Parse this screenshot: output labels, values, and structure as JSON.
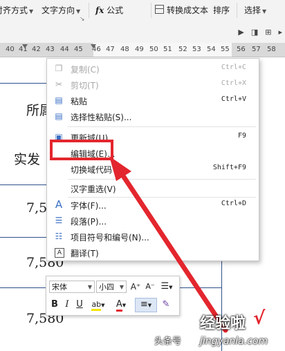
{
  "ribbon": {
    "align_mode": "对齐方式",
    "text_direction": "文字方向",
    "fx": "fx",
    "formula": "公式",
    "convert_to_text": "转换成文本",
    "sort": "排序",
    "select": "选择"
  },
  "ruler": {
    "ticks": [
      "40",
      "41",
      "42",
      "43",
      "44",
      "45",
      "46",
      "47",
      "48",
      "49",
      "50",
      "51",
      "52",
      "53",
      "54",
      "55",
      "56",
      "57",
      "58"
    ]
  },
  "document": {
    "cells": [
      "所属",
      "实发",
      "7,58",
      "7,580",
      "7,580"
    ]
  },
  "context_menu": {
    "items": [
      {
        "label": "复制(C)",
        "shortcut": "Ctrl+C",
        "icon": "copy-icon",
        "disabled": true
      },
      {
        "label": "剪切(T)",
        "shortcut": "Ctrl+X",
        "icon": "scissors-icon",
        "disabled": true
      },
      {
        "label": "粘贴",
        "shortcut": "Ctrl+V",
        "icon": "paste-icon",
        "disabled": false
      },
      {
        "label": "选择性粘贴(S)...",
        "shortcut": "",
        "icon": "paste-special-icon",
        "disabled": false
      },
      {
        "label": "更新域(U)",
        "shortcut": "F9",
        "icon": "update-field-icon",
        "disabled": false
      },
      {
        "label": "编辑域(E)...",
        "shortcut": "",
        "icon": "",
        "disabled": false
      },
      {
        "label": "切换域代码",
        "shortcut": "Shift+F9",
        "icon": "",
        "disabled": false
      },
      {
        "label": "汉字重选(V)",
        "shortcut": "",
        "icon": "",
        "disabled": false
      },
      {
        "label": "字体(F)...",
        "shortcut": "Ctrl+D",
        "icon": "font-icon",
        "disabled": false
      },
      {
        "label": "段落(P)...",
        "shortcut": "",
        "icon": "paragraph-icon",
        "disabled": false
      },
      {
        "label": "项目符号和编号(N)...",
        "shortcut": "",
        "icon": "list-icon",
        "disabled": false
      },
      {
        "label": "翻译(T)",
        "shortcut": "",
        "icon": "translate-icon",
        "disabled": false
      }
    ]
  },
  "mini_toolbar": {
    "font": "宋体",
    "size": "小四",
    "grow": "A⁺",
    "shrink": "A⁻",
    "bold": "B",
    "italic": "I",
    "underline": "U",
    "highlight": "ab",
    "font_color": "A"
  },
  "watermark": {
    "brand": "经验啦",
    "check": "√",
    "author": "头条号",
    "domain": "jingyanla.com"
  },
  "colors": {
    "accent_red": "#e3262e",
    "table_blue": "#2d4f8a"
  }
}
